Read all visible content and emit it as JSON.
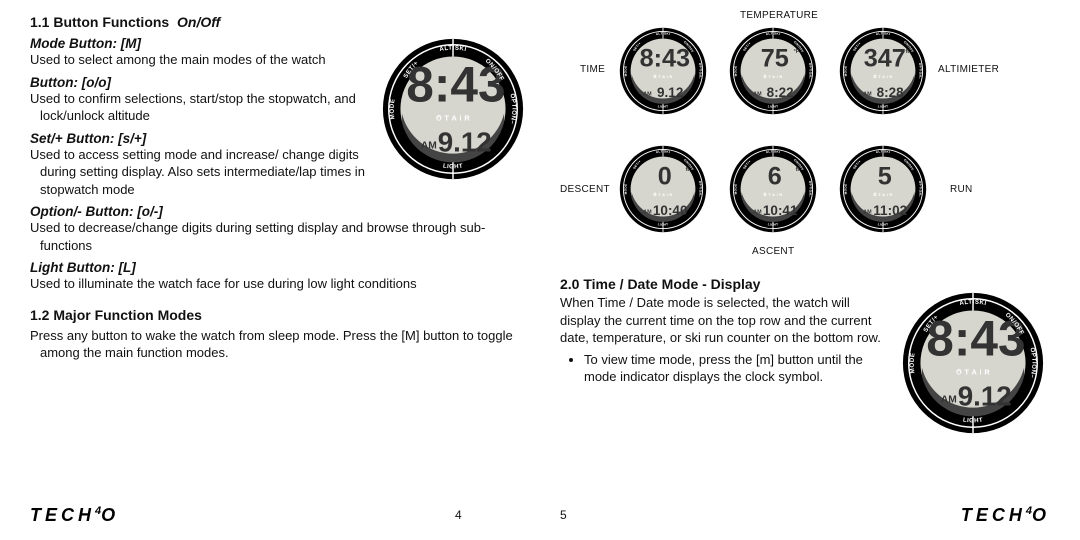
{
  "left": {
    "s11_title": "1.1 Button Functions",
    "s11_onoff": "On/Off",
    "mode_h": "Mode Button: [M]",
    "mode_t": "Used to select among the main modes of the watch",
    "oo_h": "Button: [o/o]",
    "oo_t": "Used to confirm selections, start/stop the stopwatch, and lock/unlock altitude",
    "set_h": "Set/+ Button: [s/+]",
    "set_t": "Used to access setting mode and increase/ change digits during setting display. Also sets intermediate/lap times in stopwatch mode",
    "opt_h": "Option/- Button: [o/-]",
    "opt_t": "Used to decrease/change digits during setting display and browse through sub-functions",
    "light_h": "Light Button: [L]",
    "light_t": "Used to illuminate the watch face for use during low light conditions",
    "s12_title": "1.2 Major Function Modes",
    "s12_t": "Press any button to wake the watch from sleep mode. Press the [M] button to toggle among the main function modes.",
    "page_num": "4"
  },
  "right": {
    "labels": {
      "temperature": "TEMPERATURE",
      "time": "TIME",
      "altimeter": "ALTIMIETER",
      "descent": "DESCENT",
      "ascent": "ASCENT",
      "run": "RUN"
    },
    "s20_title": "2.0 Time / Date Mode - Display",
    "s20_t": "When Time / Date mode is selected, the watch will display the current time on the top row and the current date, temperature, or ski run counter on the bottom row.",
    "s20_bullet": "To view time mode, press the [m] button until the mode indicator displays the clock symbol.",
    "page_num": "5"
  },
  "watch_labels": {
    "altiski": "ALTISKI",
    "onoff": "ON/OFF",
    "option": "OPTION–",
    "light": "LIGHT",
    "mode": "MODE",
    "set": "SET/+",
    "band": "T  A  i  R",
    "am": "AM"
  },
  "watch_big_left": {
    "main": "8:43",
    "sub": "9.12"
  },
  "watch_big_right": {
    "main": "8:43",
    "sub": "9.12"
  },
  "grid": [
    {
      "main": "8:43",
      "sub": "9.12",
      "unit": ""
    },
    {
      "main": "75",
      "sub": "8:22",
      "unit": "°F"
    },
    {
      "main": "347",
      "sub": "8:28",
      "unit": "ft"
    },
    {
      "main": "0",
      "sub": "10:40",
      "unit": "ft"
    },
    {
      "main": "6",
      "sub": "10:41",
      "unit": "ft"
    },
    {
      "main": "5",
      "sub": "11:02",
      "unit": ""
    }
  ],
  "brand": {
    "text1": "TECH",
    "sup": "4",
    "text2": "O"
  }
}
